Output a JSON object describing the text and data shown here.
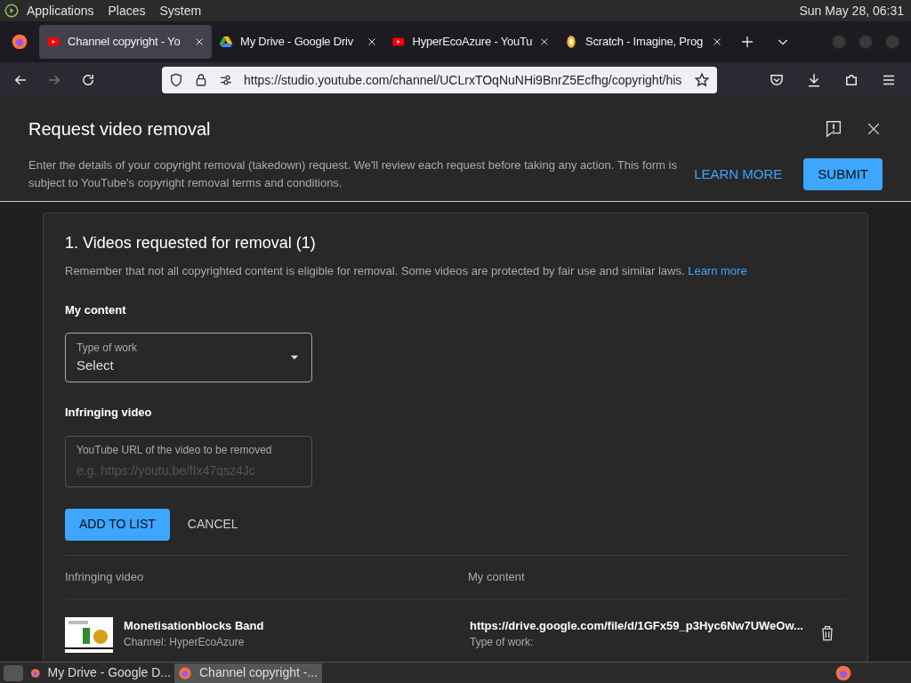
{
  "system_bar": {
    "menus": [
      "Applications",
      "Places",
      "System"
    ],
    "clock": "Sun May 28, 06:31"
  },
  "tabs": [
    {
      "title": "Channel copyright - Yo",
      "kind": "youtube",
      "selected": true
    },
    {
      "title": "My Drive - Google Driv",
      "kind": "drive",
      "selected": false
    },
    {
      "title": "HyperEcoAzure - YouTu",
      "kind": "youtube",
      "selected": false
    },
    {
      "title": "Scratch - Imagine, Prog",
      "kind": "scratch",
      "selected": false
    }
  ],
  "address": {
    "url": "https://studio.youtube.com/channel/UCLrxTOqNuNHi9BnrZ5Ecfhg/copyright/his"
  },
  "dialog": {
    "title": "Request video removal",
    "description": "Enter the details of your copyright removal (takedown) request. We'll review each request before taking any action. This form is subject to YouTube's copyright removal terms and conditions.",
    "learn_more": "LEARN MORE",
    "submit": "SUBMIT"
  },
  "section": {
    "heading": "1. Videos requested for removal (1)",
    "note": "Remember that not all copyrighted content is eligible for removal. Some videos are protected by fair use and similar laws.",
    "note_link": "Learn more",
    "my_content_label": "My content",
    "type_of_work": {
      "label": "Type of work",
      "value": "Select"
    },
    "infringing_label": "Infringing video",
    "url_field": {
      "label": "YouTube URL of the video to be removed",
      "placeholder": "e.g. https://youtu.be/fIx47qsz4Jc"
    },
    "add_button": "ADD TO LIST",
    "cancel_button": "CANCEL"
  },
  "table": {
    "columns": [
      "Infringing video",
      "My content"
    ],
    "rows": [
      {
        "title": "Monetisationblocks Band",
        "channel": "Channel: HyperEcoAzure",
        "content_url": "https://drive.google.com/file/d/1GFx59_p3Hyc6Nw7UWeOw...",
        "type_label": "Type of work:"
      }
    ]
  },
  "taskbar": [
    {
      "title": "My Drive - Google D...",
      "selected": false
    },
    {
      "title": "Channel copyright -...",
      "selected": true
    }
  ]
}
